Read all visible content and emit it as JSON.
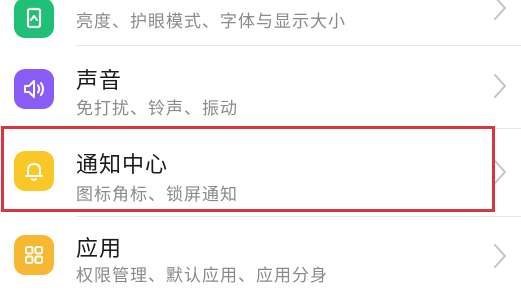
{
  "settings_list": {
    "items": [
      {
        "title": "",
        "subtitle": "亮度、护眼模式、字体与显示大小",
        "icon": "display-icon",
        "icon_color": "#1fbf75"
      },
      {
        "title": "声音",
        "subtitle": "免打扰、铃声、振动",
        "icon": "speaker-icon",
        "icon_color": "#8a5cf6"
      },
      {
        "title": "通知中心",
        "subtitle": "图标角标、锁屏通知",
        "icon": "bell-icon",
        "icon_color": "#f9c826"
      },
      {
        "title": "应用",
        "subtitle": "权限管理、默认应用、应用分身",
        "icon": "apps-grid-icon",
        "icon_color": "#f7b731"
      }
    ]
  },
  "highlight": {
    "color": "#d9343f",
    "target": "通知中心"
  },
  "chevron_icon": "chevron-right-icon"
}
